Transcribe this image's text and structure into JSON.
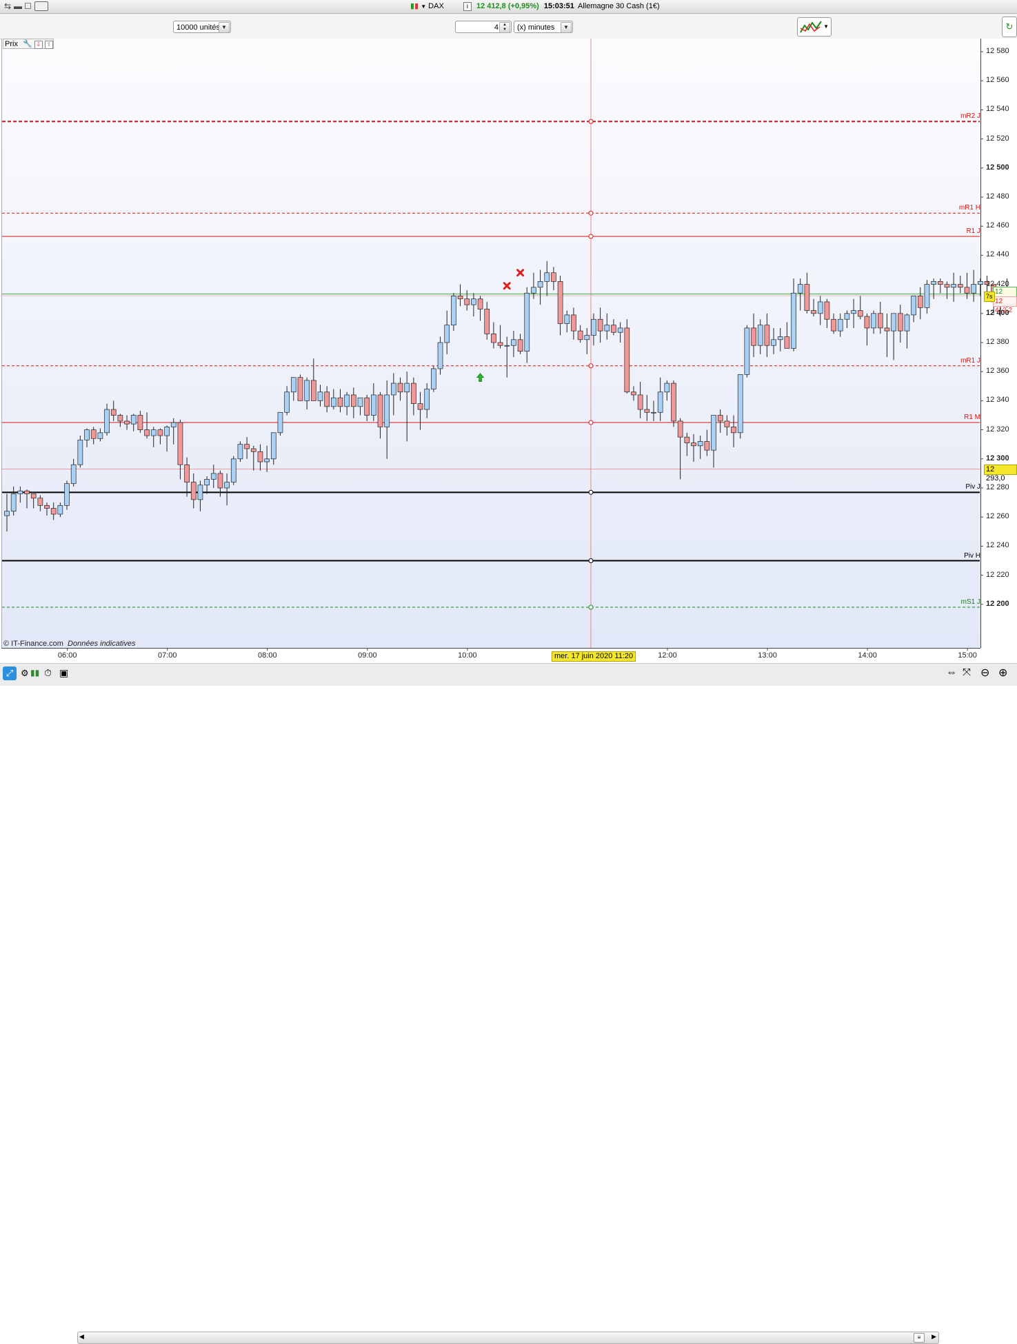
{
  "window": {
    "instrument": "DAX",
    "quote": "12 412,8 (+0,95%)",
    "time": "15:03:51",
    "name": "Allemagne 30 Cash (1€)"
  },
  "toolbar": {
    "quantity": "10000 unités",
    "period_value": "4",
    "period_unit": "(x) minutes"
  },
  "panel": {
    "label": "Prix",
    "credit_source": "© IT-Finance.com",
    "credit_note": "Données indicatives"
  },
  "crosshair": {
    "date_label": "mer. 17 juin 2020 11:20",
    "price_label": "12 293,0",
    "price": 12293.0
  },
  "price_tags": {
    "bid": "12 413,4",
    "ask": "12 412,2",
    "timer": "7s",
    "bid_value": 12413.4,
    "ask_value": 12412.2
  },
  "colors": {
    "up_candle": "#a9d1f5",
    "down_candle": "#f09898",
    "resistance": "#dd1111",
    "pivot": "#000000",
    "support": "#118811",
    "crosshair": "#f06a6a",
    "bid_line": "#5cb85c",
    "date_tag_bg": "#f5e82c"
  },
  "chart_data": {
    "type": "candlestick",
    "ylim": [
      12175,
      12595
    ],
    "y_ticks": [
      {
        "v": 12580,
        "label": "12 580",
        "bold": false
      },
      {
        "v": 12560,
        "label": "12 560",
        "bold": false
      },
      {
        "v": 12540,
        "label": "12 540",
        "bold": false
      },
      {
        "v": 12520,
        "label": "12 520",
        "bold": false
      },
      {
        "v": 12500,
        "label": "12 500",
        "bold": true
      },
      {
        "v": 12480,
        "label": "12 480",
        "bold": false
      },
      {
        "v": 12460,
        "label": "12 460",
        "bold": false
      },
      {
        "v": 12440,
        "label": "12 440",
        "bold": false
      },
      {
        "v": 12420,
        "label": "12 420",
        "bold": false
      },
      {
        "v": 12400,
        "label": "12 400",
        "bold": true
      },
      {
        "v": 12380,
        "label": "12 380",
        "bold": false
      },
      {
        "v": 12360,
        "label": "12 360",
        "bold": false
      },
      {
        "v": 12340,
        "label": "12 340",
        "bold": false
      },
      {
        "v": 12320,
        "label": "12 320",
        "bold": false
      },
      {
        "v": 12300,
        "label": "12 300",
        "bold": true
      },
      {
        "v": 12280,
        "label": "12 280",
        "bold": false
      },
      {
        "v": 12260,
        "label": "12 260",
        "bold": false
      },
      {
        "v": 12240,
        "label": "12 240",
        "bold": false
      },
      {
        "v": 12220,
        "label": "12 220",
        "bold": false
      },
      {
        "v": 12200,
        "label": "12 200",
        "bold": true
      }
    ],
    "x_ticks": [
      {
        "label": "06:00",
        "i": 10
      },
      {
        "label": "07:00",
        "i": 25
      },
      {
        "label": "08:00",
        "i": 40
      },
      {
        "label": "09:00",
        "i": 55
      },
      {
        "label": "10:00",
        "i": 70
      },
      {
        "label": "12:00",
        "i": 100
      },
      {
        "label": "13:00",
        "i": 115
      },
      {
        "label": "14:00",
        "i": 130
      },
      {
        "label": "15:00",
        "i": 145
      }
    ],
    "levels": [
      {
        "name": "mR2 J",
        "value": 12532,
        "style": "dashed",
        "kind": "resistance",
        "width": 2
      },
      {
        "name": "mR1 H",
        "value": 12469,
        "style": "dashed",
        "kind": "resistance",
        "width": 1
      },
      {
        "name": "R1 J",
        "value": 12453,
        "style": "solid",
        "kind": "resistance",
        "width": 1
      },
      {
        "name": "mR1 J",
        "value": 12364,
        "style": "dashed",
        "kind": "resistance",
        "width": 1
      },
      {
        "name": "R1 M",
        "value": 12325,
        "style": "solid",
        "kind": "resistance",
        "width": 1
      },
      {
        "name": "Piv J",
        "value": 12277,
        "style": "solid",
        "kind": "pivot",
        "width": 2
      },
      {
        "name": "Piv H",
        "value": 12230,
        "style": "solid",
        "kind": "pivot",
        "width": 2
      },
      {
        "name": "mS1 J",
        "value": 12198,
        "style": "dashed",
        "kind": "support",
        "width": 1
      }
    ],
    "candles": [
      [
        12261,
        12276,
        12250,
        12264
      ],
      [
        12264,
        12281,
        12261,
        12276
      ],
      [
        12276,
        12281,
        12270,
        12278
      ],
      [
        12278,
        12279,
        12266,
        12276
      ],
      [
        12276,
        12276,
        12266,
        12273
      ],
      [
        12273,
        12275,
        12264,
        12268
      ],
      [
        12268,
        12270,
        12261,
        12266
      ],
      [
        12266,
        12270,
        12258,
        12262
      ],
      [
        12262,
        12270,
        12260,
        12268
      ],
      [
        12268,
        12285,
        12265,
        12283
      ],
      [
        12283,
        12300,
        12281,
        12296
      ],
      [
        12296,
        12316,
        12294,
        12313
      ],
      [
        12313,
        12321,
        12308,
        12320
      ],
      [
        12320,
        12322,
        12310,
        12314
      ],
      [
        12314,
        12321,
        12312,
        12318
      ],
      [
        12318,
        12338,
        12316,
        12334
      ],
      [
        12334,
        12340,
        12326,
        12330
      ],
      [
        12330,
        12331,
        12322,
        12326
      ],
      [
        12326,
        12330,
        12320,
        12324
      ],
      [
        12324,
        12331,
        12319,
        12330
      ],
      [
        12330,
        12333,
        12318,
        12320
      ],
      [
        12320,
        12332,
        12314,
        12316
      ],
      [
        12316,
        12322,
        12308,
        12320
      ],
      [
        12320,
        12321,
        12310,
        12316
      ],
      [
        12316,
        12323,
        12305,
        12322
      ],
      [
        12322,
        12328,
        12310,
        12325
      ],
      [
        12325,
        12327,
        12286,
        12296
      ],
      [
        12296,
        12301,
        12274,
        12284
      ],
      [
        12284,
        12290,
        12266,
        12272
      ],
      [
        12272,
        12285,
        12264,
        12282
      ],
      [
        12282,
        12288,
        12276,
        12286
      ],
      [
        12286,
        12296,
        12280,
        12290
      ],
      [
        12290,
        12292,
        12274,
        12280
      ],
      [
        12280,
        12290,
        12268,
        12284
      ],
      [
        12284,
        12302,
        12282,
        12300
      ],
      [
        12300,
        12312,
        12298,
        12310
      ],
      [
        12310,
        12315,
        12300,
        12307
      ],
      [
        12307,
        12309,
        12292,
        12305
      ],
      [
        12305,
        12310,
        12292,
        12298
      ],
      [
        12298,
        12309,
        12291,
        12300
      ],
      [
        12300,
        12316,
        12296,
        12318
      ],
      [
        12318,
        12332,
        12316,
        12332
      ],
      [
        12332,
        12350,
        12330,
        12346
      ],
      [
        12346,
        12356,
        12340,
        12356
      ],
      [
        12356,
        12358,
        12340,
        12340
      ],
      [
        12340,
        12356,
        12334,
        12354
      ],
      [
        12354,
        12369,
        12340,
        12340
      ],
      [
        12340,
        12351,
        12336,
        12346
      ],
      [
        12346,
        12350,
        12332,
        12336
      ],
      [
        12336,
        12348,
        12334,
        12342
      ],
      [
        12342,
        12348,
        12332,
        12336
      ],
      [
        12336,
        12346,
        12330,
        12344
      ],
      [
        12344,
        12349,
        12328,
        12336
      ],
      [
        12336,
        12342,
        12330,
        12342
      ],
      [
        12342,
        12344,
        12326,
        12330
      ],
      [
        12330,
        12352,
        12326,
        12344
      ],
      [
        12344,
        12346,
        12314,
        12322
      ],
      [
        12322,
        12354,
        12300,
        12344
      ],
      [
        12344,
        12359,
        12330,
        12352
      ],
      [
        12352,
        12356,
        12340,
        12346
      ],
      [
        12346,
        12360,
        12312,
        12352
      ],
      [
        12352,
        12356,
        12330,
        12338
      ],
      [
        12338,
        12346,
        12320,
        12334
      ],
      [
        12334,
        12352,
        12328,
        12348
      ],
      [
        12348,
        12364,
        12346,
        12362
      ],
      [
        12362,
        12384,
        12358,
        12380
      ],
      [
        12380,
        12402,
        12372,
        12392
      ],
      [
        12392,
        12414,
        12388,
        12412
      ],
      [
        12412,
        12420,
        12405,
        12410
      ],
      [
        12410,
        12416,
        12402,
        12406
      ],
      [
        12406,
        12414,
        12398,
        12410
      ],
      [
        12410,
        12412,
        12395,
        12403
      ],
      [
        12403,
        12408,
        12382,
        12386
      ],
      [
        12386,
        12394,
        12376,
        12380
      ],
      [
        12380,
        12392,
        12376,
        12378
      ],
      [
        12378,
        12384,
        12356,
        12378
      ],
      [
        12378,
        12388,
        12370,
        12382
      ],
      [
        12382,
        12386,
        12372,
        12374
      ],
      [
        12374,
        12418,
        12366,
        12414
      ],
      [
        12414,
        12428,
        12410,
        12418
      ],
      [
        12418,
        12430,
        12406,
        12422
      ],
      [
        12422,
        12436,
        12412,
        12428
      ],
      [
        12428,
        12432,
        12416,
        12422
      ],
      [
        12422,
        12426,
        12385,
        12393
      ],
      [
        12393,
        12402,
        12387,
        12399
      ],
      [
        12399,
        12404,
        12382,
        12388
      ],
      [
        12388,
        12392,
        12380,
        12382
      ],
      [
        12382,
        12390,
        12372,
        12385
      ],
      [
        12385,
        12400,
        12378,
        12396
      ],
      [
        12396,
        12404,
        12380,
        12388
      ],
      [
        12388,
        12400,
        12382,
        12392
      ],
      [
        12392,
        12396,
        12385,
        12387
      ],
      [
        12387,
        12394,
        12380,
        12390
      ],
      [
        12390,
        12396,
        12345,
        12346
      ],
      [
        12346,
        12350,
        12340,
        12344
      ],
      [
        12344,
        12353,
        12328,
        12334
      ],
      [
        12334,
        12344,
        12326,
        12332
      ],
      [
        12332,
        12340,
        12326,
        12332
      ],
      [
        12332,
        12356,
        12326,
        12346
      ],
      [
        12346,
        12354,
        12340,
        12352
      ],
      [
        12352,
        12354,
        12322,
        12326
      ],
      [
        12326,
        12328,
        12286,
        12315
      ],
      [
        12315,
        12318,
        12302,
        12311
      ],
      [
        12311,
        12317,
        12298,
        12309
      ],
      [
        12309,
        12316,
        12300,
        12312
      ],
      [
        12312,
        12320,
        12302,
        12306
      ],
      [
        12306,
        12330,
        12294,
        12330
      ],
      [
        12330,
        12334,
        12318,
        12326
      ],
      [
        12326,
        12330,
        12316,
        12322
      ],
      [
        12322,
        12330,
        12308,
        12318
      ],
      [
        12318,
        12358,
        12314,
        12358
      ],
      [
        12358,
        12392,
        12356,
        12390
      ],
      [
        12390,
        12400,
        12370,
        12378
      ],
      [
        12378,
        12396,
        12372,
        12392
      ],
      [
        12392,
        12400,
        12370,
        12378
      ],
      [
        12378,
        12390,
        12372,
        12382
      ],
      [
        12382,
        12390,
        12374,
        12384
      ],
      [
        12384,
        12394,
        12376,
        12376
      ],
      [
        12376,
        12424,
        12374,
        12414
      ],
      [
        12414,
        12424,
        12402,
        12420
      ],
      [
        12420,
        12428,
        12400,
        12402
      ],
      [
        12402,
        12410,
        12398,
        12400
      ],
      [
        12400,
        12412,
        12392,
        12408
      ],
      [
        12408,
        12410,
        12390,
        12396
      ],
      [
        12396,
        12400,
        12386,
        12388
      ],
      [
        12388,
        12400,
        12384,
        12396
      ],
      [
        12396,
        12402,
        12390,
        12400
      ],
      [
        12400,
        12410,
        12390,
        12402
      ],
      [
        12402,
        12412,
        12396,
        12398
      ],
      [
        12398,
        12400,
        12378,
        12390
      ],
      [
        12390,
        12402,
        12386,
        12400
      ],
      [
        12400,
        12408,
        12386,
        12390
      ],
      [
        12390,
        12400,
        12370,
        12388
      ],
      [
        12388,
        12400,
        12368,
        12400
      ],
      [
        12400,
        12406,
        12380,
        12388
      ],
      [
        12388,
        12400,
        12376,
        12399
      ],
      [
        12399,
        12412,
        12394,
        12412
      ],
      [
        12412,
        12418,
        12396,
        12404
      ],
      [
        12404,
        12423,
        12400,
        12420
      ],
      [
        12420,
        12424,
        12410,
        12422
      ],
      [
        12422,
        12424,
        12414,
        12420
      ],
      [
        12420,
        12422,
        12410,
        12418
      ],
      [
        12418,
        12428,
        12408,
        12420
      ],
      [
        12420,
        12426,
        12414,
        12418
      ],
      [
        12418,
        12428,
        12410,
        12414
      ],
      [
        12414,
        12430,
        12408,
        12420
      ],
      [
        12420,
        12424,
        12412,
        12422
      ],
      [
        12422,
        12426,
        12414,
        12420
      ],
      [
        12420,
        12420,
        12400,
        12408
      ],
      [
        12408,
        12412,
        12398,
        12410
      ],
      [
        12410,
        12424,
        12404,
        12412
      ]
    ],
    "markers": [
      {
        "type": "buy-arrow",
        "i": 71,
        "price": 12356
      },
      {
        "type": "sell-cross",
        "i": 75,
        "price": 12419
      },
      {
        "type": "sell-cross",
        "i": 77,
        "price": 12428
      }
    ]
  }
}
